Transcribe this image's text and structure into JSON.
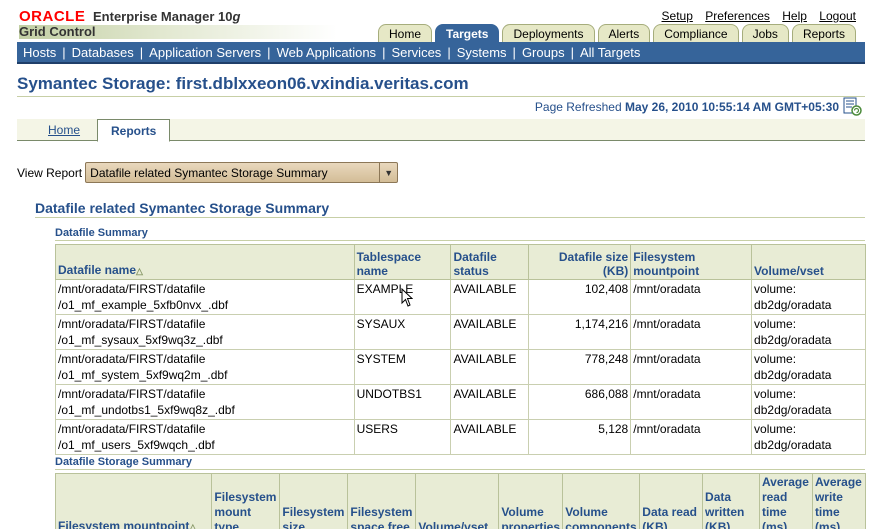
{
  "brand": {
    "oracle": "ORACLE",
    "product": "Enterprise Manager 10",
    "product_suffix": "g",
    "subtitle": "Grid Control"
  },
  "global_links": [
    "Setup",
    "Preferences",
    "Help",
    "Logout"
  ],
  "tabs": [
    {
      "label": "Home",
      "active": false
    },
    {
      "label": "Targets",
      "active": true
    },
    {
      "label": "Deployments",
      "active": false
    },
    {
      "label": "Alerts",
      "active": false
    },
    {
      "label": "Compliance",
      "active": false
    },
    {
      "label": "Jobs",
      "active": false
    },
    {
      "label": "Reports",
      "active": false
    }
  ],
  "nav": [
    "Hosts",
    "Databases",
    "Application Servers",
    "Web Applications",
    "Services",
    "Systems",
    "Groups",
    "All Targets"
  ],
  "page_title": "Symantec Storage: first.dblxxeon06.vxindia.veritas.com",
  "refresh": {
    "label": "Page Refreshed",
    "timestamp": "May 26, 2010 10:55:14 AM GMT+05:30"
  },
  "subtabs": {
    "home": "Home",
    "reports": "Reports"
  },
  "view_report": {
    "label": "View Report",
    "selected": "Datafile related Symantec Storage Summary"
  },
  "section_title": "Datafile related Symantec Storage Summary",
  "datafile_summary": {
    "title": "Datafile Summary",
    "columns": [
      "Datafile name",
      "Tablespace name",
      "Datafile status",
      "Datafile size (KB)",
      "Filesystem mountpoint",
      "Volume/vset"
    ],
    "rows": [
      {
        "name1": "/mnt/oradata/FIRST/datafile",
        "name2": "/o1_mf_example_5xfb0nvx_.dbf",
        "tablespace": "EXAMPLE",
        "status": "AVAILABLE",
        "size": "102,408",
        "mount": "/mnt/oradata",
        "vol1": "volume:",
        "vol2": "db2dg/oradata"
      },
      {
        "name1": "/mnt/oradata/FIRST/datafile",
        "name2": "/o1_mf_sysaux_5xf9wq3z_.dbf",
        "tablespace": "SYSAUX",
        "status": "AVAILABLE",
        "size": "1,174,216",
        "mount": "/mnt/oradata",
        "vol1": "volume:",
        "vol2": "db2dg/oradata"
      },
      {
        "name1": "/mnt/oradata/FIRST/datafile",
        "name2": "/o1_mf_system_5xf9wq2m_.dbf",
        "tablespace": "SYSTEM",
        "status": "AVAILABLE",
        "size": "778,248",
        "mount": "/mnt/oradata",
        "vol1": "volume:",
        "vol2": "db2dg/oradata"
      },
      {
        "name1": "/mnt/oradata/FIRST/datafile",
        "name2": "/o1_mf_undotbs1_5xf9wq8z_.dbf",
        "tablespace": "UNDOTBS1",
        "status": "AVAILABLE",
        "size": "686,088",
        "mount": "/mnt/oradata",
        "vol1": "volume:",
        "vol2": "db2dg/oradata"
      },
      {
        "name1": "/mnt/oradata/FIRST/datafile",
        "name2": "/o1_mf_users_5xf9wqch_.dbf",
        "tablespace": "USERS",
        "status": "AVAILABLE",
        "size": "5,128",
        "mount": "/mnt/oradata",
        "vol1": "volume:",
        "vol2": "db2dg/oradata"
      }
    ]
  },
  "storage_summary": {
    "title": "Datafile Storage Summary",
    "columns": [
      "Filesystem mountpoint",
      "Filesystem mount type",
      "Filesystem size",
      "Filesystem space free",
      "Volume/vset",
      "Volume properties",
      "Volume components",
      "Data read (KB)",
      "Data written (KB)",
      "Average read time (ms)",
      "Average write time (ms)"
    ]
  },
  "colors": {
    "header_blue": "#36649a",
    "title_blue": "#26508b",
    "oracle_red": "#ff0000",
    "table_header_bg": "#e8ecd5"
  }
}
